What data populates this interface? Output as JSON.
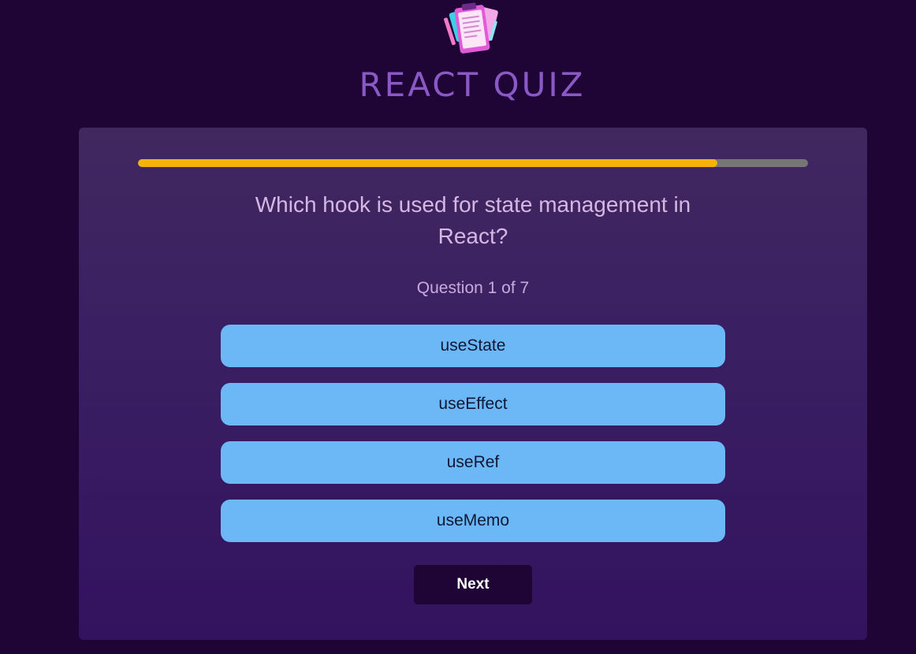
{
  "header": {
    "logo_icon": "quiz-clipboard-icon",
    "title": "REACT QUIZ"
  },
  "quiz": {
    "progress": 0.865,
    "question": "Which hook is used for state management in React?",
    "counter": "Question 1 of 7",
    "options": [
      {
        "label": "useState"
      },
      {
        "label": "useEffect"
      },
      {
        "label": "useRef"
      },
      {
        "label": "useMemo"
      }
    ],
    "next_label": "Next"
  },
  "colors": {
    "background": "#1f0436",
    "title": "#8b59c6",
    "progress_fill": "#f5b20b",
    "progress_track": "#767676",
    "option_bg": "#6cb8f7",
    "next_bg": "#1f0436"
  }
}
